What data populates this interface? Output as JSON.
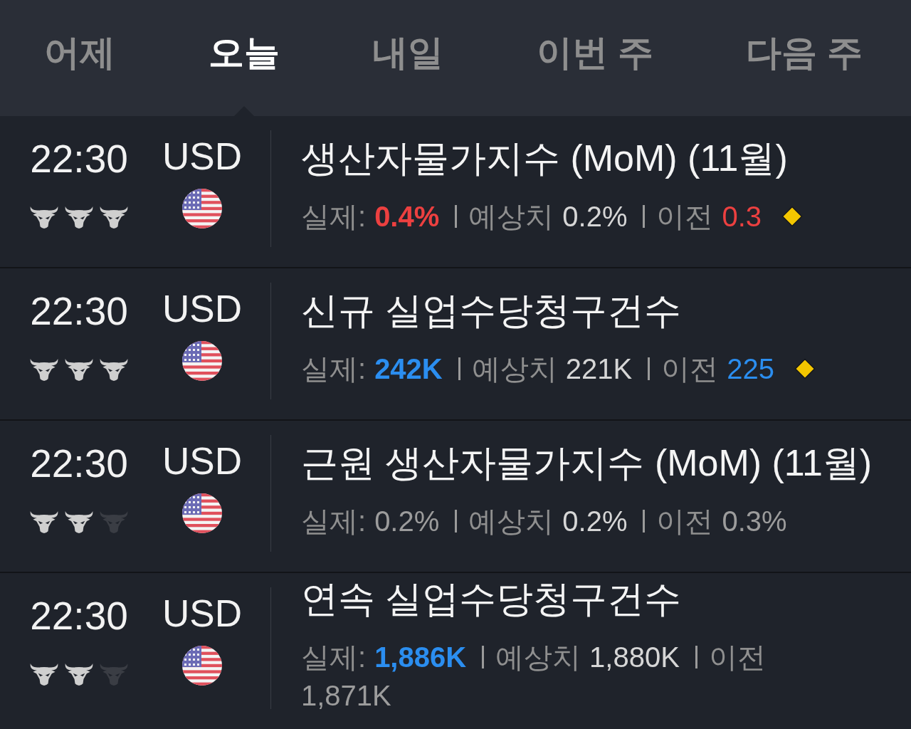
{
  "tabs": [
    {
      "label": "어제",
      "selected": false
    },
    {
      "label": "오늘",
      "selected": true
    },
    {
      "label": "내일",
      "selected": false
    },
    {
      "label": "이번 주",
      "selected": false
    },
    {
      "label": "다음 주",
      "selected": false
    }
  ],
  "events": [
    {
      "time": "22:30",
      "bulls": [
        {
          "filled": true
        },
        {
          "filled": true
        },
        {
          "filled": true
        }
      ],
      "currency": "USD",
      "title": "생산자물가지수 (MoM) (11월)",
      "actual_label": "실제:",
      "actual": {
        "value": "0.4%",
        "color": "#ec4040",
        "bold": true
      },
      "forecast_label": "예상치",
      "forecast": "0.2%",
      "previous_label": "이전",
      "previous": {
        "value": "0.3",
        "color": "#ec4040"
      },
      "diamond": true
    },
    {
      "time": "22:30",
      "bulls": [
        {
          "filled": true
        },
        {
          "filled": true
        },
        {
          "filled": true
        }
      ],
      "currency": "USD",
      "title": "신규 실업수당청구건수",
      "actual_label": "실제:",
      "actual": {
        "value": "242K",
        "color": "#2b8ef0",
        "bold": true
      },
      "forecast_label": "예상치",
      "forecast": "221K",
      "previous_label": "이전",
      "previous": {
        "value": "225",
        "color": "#2b8ef0"
      },
      "diamond": true
    },
    {
      "time": "22:30",
      "bulls": [
        {
          "filled": true
        },
        {
          "filled": true
        },
        {
          "filled": false
        }
      ],
      "currency": "USD",
      "title": "근원 생산자물가지수 (MoM) (11월)",
      "actual_label": "실제:",
      "actual": {
        "value": "0.2%",
        "color": "#9c9c9c",
        "bold": false
      },
      "forecast_label": "예상치",
      "forecast": "0.2%",
      "previous_label": "이전",
      "previous": {
        "value": "0.3%",
        "color": "#9c9c9c"
      },
      "diamond": false
    },
    {
      "time": "22:30",
      "bulls": [
        {
          "filled": true
        },
        {
          "filled": true
        },
        {
          "filled": false
        }
      ],
      "currency": "USD",
      "title": "연속 실업수당청구건수",
      "actual_label": "실제:",
      "actual": {
        "value": "1,886K",
        "color": "#2b8ef0",
        "bold": true
      },
      "forecast_label": "예상치",
      "forecast": "1,880K",
      "previous_label": "이전",
      "previous": {
        "value": "1,871K",
        "color": "#9c9c9c"
      },
      "diamond": false
    }
  ]
}
